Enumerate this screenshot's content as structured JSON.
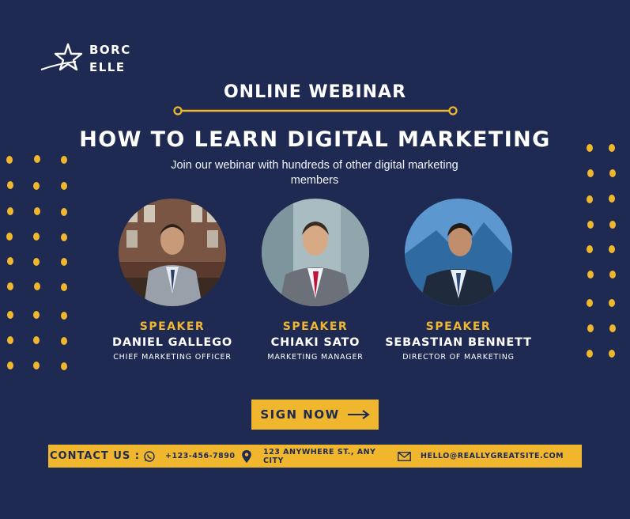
{
  "brand": {
    "name_line1": "BORC",
    "name_line2": "ELLE"
  },
  "header": {
    "eyebrow": "ONLINE WEBINAR",
    "headline": "HOW TO LEARN DIGITAL MARKETING",
    "subtitle": "Join our webinar with hundreds of other digital marketing members"
  },
  "speakers": [
    {
      "role": "SPEAKER",
      "name": "DANIEL GALLEGO",
      "position": "CHIEF MARKETING OFFICER"
    },
    {
      "role": "SPEAKER",
      "name": "CHIAKI SATO",
      "position": "MARKETING MANAGER"
    },
    {
      "role": "SPEAKER",
      "name": "SEBASTIAN BENNETT",
      "position": "DIRECTOR OF MARKETING"
    }
  ],
  "cta": {
    "label": "SIGN NOW",
    "icon": "arrow-right-icon"
  },
  "contact": {
    "label": "CONTACT US :",
    "phone": "+123-456-7890",
    "address": "123 ANYWHERE ST., ANY CITY",
    "email": "HELLO@REALLYGREATSITE.COM",
    "icons": [
      "whatsapp-icon",
      "location-pin-icon",
      "envelope-icon"
    ]
  },
  "colors": {
    "background": "#1e2a52",
    "accent": "#f0b62e",
    "text": "#ffffff"
  }
}
